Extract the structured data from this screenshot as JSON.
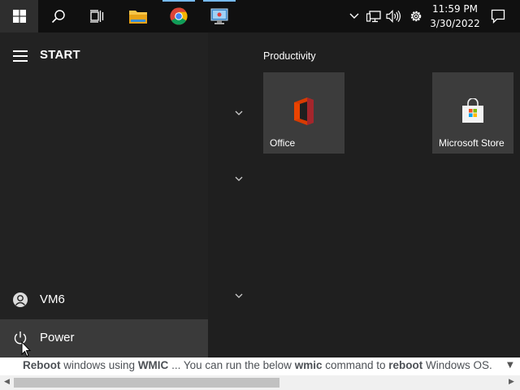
{
  "taskbar": {
    "icons": [
      "windows-start-icon",
      "search-icon",
      "task-view-icon",
      "file-explorer-icon",
      "chrome-icon",
      "remote-desktop-icon"
    ],
    "clock_time": "11:59 PM",
    "clock_date": "3/30/2022",
    "tray_icons": [
      "chevron-up-icon",
      "network-icon",
      "volume-icon",
      "settings-gear-icon",
      "notifications-icon"
    ]
  },
  "start_menu": {
    "title": "START",
    "user_name": "VM6",
    "power_label": "Power"
  },
  "tiles": {
    "group_title": "Productivity",
    "items": [
      {
        "label": "Office",
        "icon": "office-icon"
      },
      {
        "label": "Microsoft Store",
        "icon": "store-icon"
      }
    ]
  },
  "browser_snippet": {
    "parts": [
      {
        "text": "Reboot",
        "bold": true
      },
      {
        "text": " windows using ",
        "bold": false
      },
      {
        "text": "WMIC",
        "bold": true
      },
      {
        "text": " ... You can run the below ",
        "bold": false
      },
      {
        "text": "wmic",
        "bold": true
      },
      {
        "text": " command to ",
        "bold": false
      },
      {
        "text": "reboot",
        "bold": true
      },
      {
        "text": " Windows OS.",
        "bold": false
      }
    ]
  },
  "colors": {
    "taskbar_bg": "#101010",
    "start_pane_bg": "#222222",
    "tile_bg": "#3c3c3c",
    "accent": "#76b9ed"
  }
}
